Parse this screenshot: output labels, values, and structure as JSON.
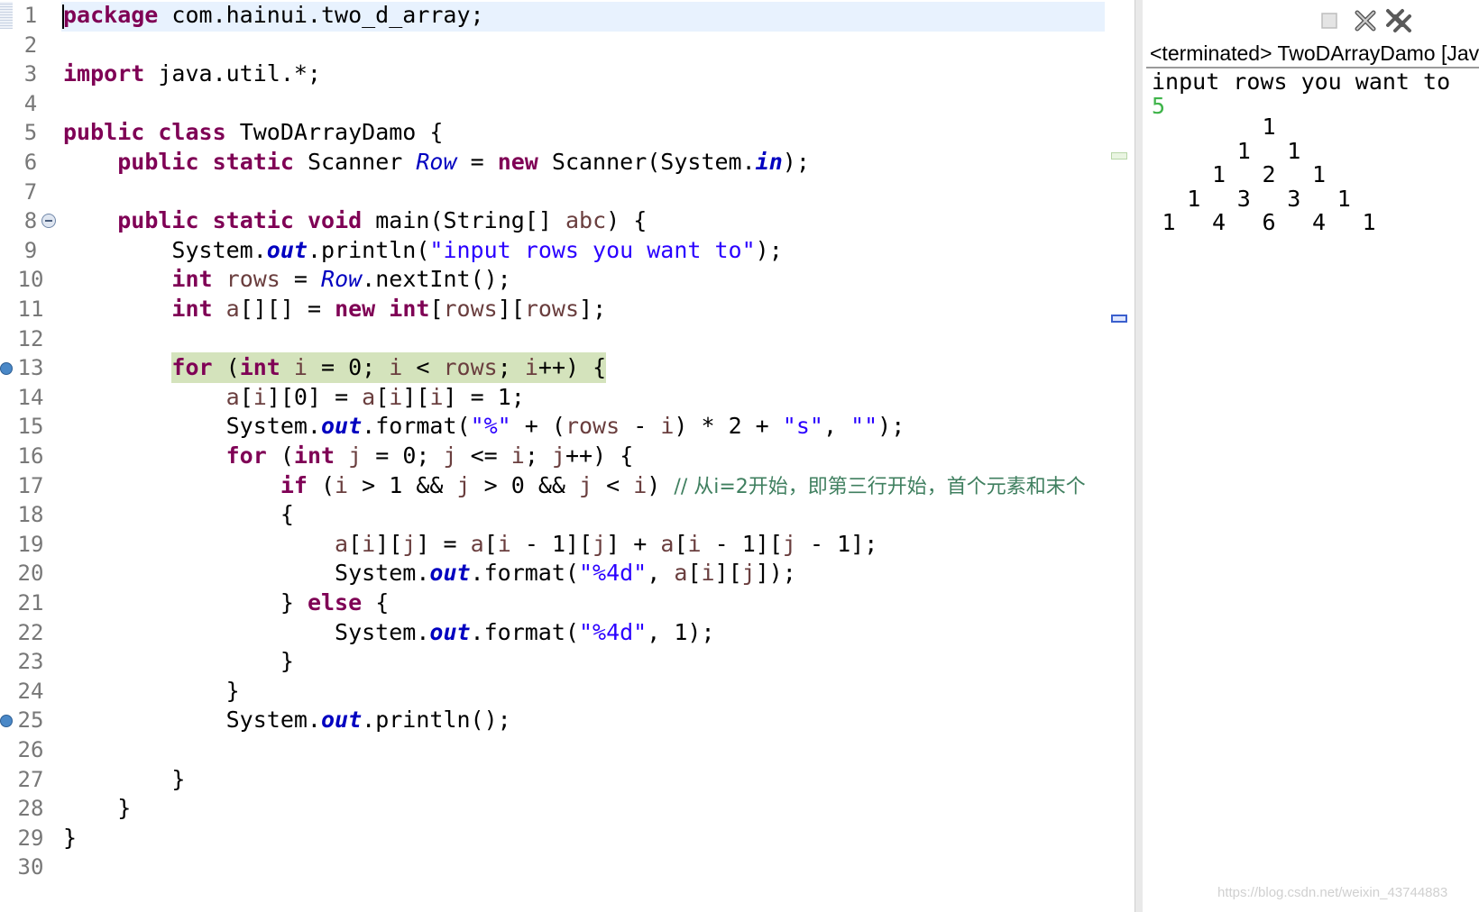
{
  "editor": {
    "lines": [
      {
        "n": "1",
        "segs": [
          [
            "kw",
            "package"
          ],
          [
            "",
            " com.hainui.two_d_array;"
          ]
        ]
      },
      {
        "n": "2",
        "segs": []
      },
      {
        "n": "3",
        "segs": [
          [
            "kw",
            "import"
          ],
          [
            "",
            " java.util.*;"
          ]
        ]
      },
      {
        "n": "4",
        "segs": []
      },
      {
        "n": "5",
        "segs": [
          [
            "kw",
            "public"
          ],
          [
            "",
            " "
          ],
          [
            "kw",
            "class"
          ],
          [
            "",
            " TwoDArrayDamo {"
          ]
        ]
      },
      {
        "n": "6",
        "segs": [
          [
            "",
            "    "
          ],
          [
            "kw",
            "public"
          ],
          [
            "",
            " "
          ],
          [
            "kw",
            "static"
          ],
          [
            "",
            " Scanner "
          ],
          [
            "sfld",
            "Row"
          ],
          [
            "",
            " = "
          ],
          [
            "kw",
            "new"
          ],
          [
            "",
            " Scanner(System."
          ],
          [
            "fld",
            "in"
          ],
          [
            "",
            ");"
          ]
        ]
      },
      {
        "n": "7",
        "segs": []
      },
      {
        "n": "8",
        "segs": [
          [
            "",
            "    "
          ],
          [
            "kw",
            "public"
          ],
          [
            "",
            " "
          ],
          [
            "kw",
            "static"
          ],
          [
            "",
            " "
          ],
          [
            "kw",
            "void"
          ],
          [
            "",
            " main(String[] "
          ],
          [
            "var",
            "abc"
          ],
          [
            "",
            ") {"
          ]
        ]
      },
      {
        "n": "9",
        "segs": [
          [
            "",
            "        System."
          ],
          [
            "fld",
            "out"
          ],
          [
            "",
            ".println("
          ],
          [
            "str",
            "\"input rows you want to\""
          ],
          [
            "",
            ");"
          ]
        ]
      },
      {
        "n": "10",
        "segs": [
          [
            "",
            "        "
          ],
          [
            "kw",
            "int"
          ],
          [
            "",
            " "
          ],
          [
            "var",
            "rows"
          ],
          [
            "",
            " = "
          ],
          [
            "sfld",
            "Row"
          ],
          [
            "",
            ".nextInt();"
          ]
        ]
      },
      {
        "n": "11",
        "segs": [
          [
            "",
            "        "
          ],
          [
            "kw",
            "int"
          ],
          [
            "",
            " "
          ],
          [
            "var",
            "a"
          ],
          [
            "",
            "[][] = "
          ],
          [
            "kw",
            "new"
          ],
          [
            "",
            " "
          ],
          [
            "kw",
            "int"
          ],
          [
            "",
            "["
          ],
          [
            "var",
            "rows"
          ],
          [
            "",
            "]["
          ],
          [
            "var",
            "rows"
          ],
          [
            "",
            "];"
          ]
        ]
      },
      {
        "n": "12",
        "segs": []
      },
      {
        "n": "13",
        "segs": [
          [
            "",
            "        "
          ],
          [
            "hlkw",
            "for"
          ],
          [
            "hl",
            " ("
          ],
          [
            "hlkw",
            "int"
          ],
          [
            "hl",
            " "
          ],
          [
            "hlvar",
            "i"
          ],
          [
            "hl",
            " = 0; "
          ],
          [
            "hlvar",
            "i"
          ],
          [
            "hl",
            " < "
          ],
          [
            "hlvar",
            "rows"
          ],
          [
            "hl",
            "; "
          ],
          [
            "hlvar",
            "i"
          ],
          [
            "hl",
            "++) {"
          ]
        ]
      },
      {
        "n": "14",
        "segs": [
          [
            "",
            "            "
          ],
          [
            "var",
            "a"
          ],
          [
            "",
            "["
          ],
          [
            "var",
            "i"
          ],
          [
            "",
            "][0] = "
          ],
          [
            "var",
            "a"
          ],
          [
            "",
            "["
          ],
          [
            "var",
            "i"
          ],
          [
            "",
            "]["
          ],
          [
            "var",
            "i"
          ],
          [
            "",
            "] = 1;"
          ]
        ]
      },
      {
        "n": "15",
        "segs": [
          [
            "",
            "            System."
          ],
          [
            "fld",
            "out"
          ],
          [
            "",
            ".format("
          ],
          [
            "str",
            "\"%\""
          ],
          [
            "",
            " + ("
          ],
          [
            "var",
            "rows"
          ],
          [
            "",
            " - "
          ],
          [
            "var",
            "i"
          ],
          [
            "",
            ") * 2 + "
          ],
          [
            "str",
            "\"s\""
          ],
          [
            "",
            ", "
          ],
          [
            "str",
            "\"\""
          ],
          [
            "",
            ");"
          ]
        ]
      },
      {
        "n": "16",
        "segs": [
          [
            "",
            "            "
          ],
          [
            "kw",
            "for"
          ],
          [
            "",
            " ("
          ],
          [
            "kw",
            "int"
          ],
          [
            "",
            " "
          ],
          [
            "var",
            "j"
          ],
          [
            "",
            " = 0; "
          ],
          [
            "var",
            "j"
          ],
          [
            "",
            " <= "
          ],
          [
            "var",
            "i"
          ],
          [
            "",
            "; "
          ],
          [
            "var",
            "j"
          ],
          [
            "",
            "++) {"
          ]
        ]
      },
      {
        "n": "17",
        "segs": [
          [
            "",
            "                "
          ],
          [
            "kw",
            "if"
          ],
          [
            "",
            " ("
          ],
          [
            "var",
            "i"
          ],
          [
            "",
            " > 1 && "
          ],
          [
            "var",
            "j"
          ],
          [
            "",
            " > 0 && "
          ],
          [
            "var",
            "j"
          ],
          [
            "",
            " < "
          ],
          [
            "var",
            "i"
          ],
          [
            "",
            ") "
          ],
          [
            "cmt",
            "// 从i=2开始，即第三行开始，首个元素和末个"
          ]
        ]
      },
      {
        "n": "18",
        "segs": [
          [
            "",
            "                {"
          ]
        ]
      },
      {
        "n": "19",
        "segs": [
          [
            "",
            "                    "
          ],
          [
            "var",
            "a"
          ],
          [
            "",
            "["
          ],
          [
            "var",
            "i"
          ],
          [
            "",
            "]["
          ],
          [
            "var",
            "j"
          ],
          [
            "",
            "] = "
          ],
          [
            "var",
            "a"
          ],
          [
            "",
            "["
          ],
          [
            "var",
            "i"
          ],
          [
            "",
            " - 1]["
          ],
          [
            "var",
            "j"
          ],
          [
            "",
            "] + "
          ],
          [
            "var",
            "a"
          ],
          [
            "",
            "["
          ],
          [
            "var",
            "i"
          ],
          [
            "",
            " - 1]["
          ],
          [
            "var",
            "j"
          ],
          [
            "",
            " - 1];"
          ]
        ]
      },
      {
        "n": "20",
        "segs": [
          [
            "",
            "                    System."
          ],
          [
            "fld",
            "out"
          ],
          [
            "",
            ".format("
          ],
          [
            "str",
            "\"%4d\""
          ],
          [
            "",
            ", "
          ],
          [
            "var",
            "a"
          ],
          [
            "",
            "["
          ],
          [
            "var",
            "i"
          ],
          [
            "",
            "]["
          ],
          [
            "var",
            "j"
          ],
          [
            "",
            "]);"
          ]
        ]
      },
      {
        "n": "21",
        "segs": [
          [
            "",
            "                } "
          ],
          [
            "kw",
            "else"
          ],
          [
            "",
            " {"
          ]
        ]
      },
      {
        "n": "22",
        "segs": [
          [
            "",
            "                    System."
          ],
          [
            "fld",
            "out"
          ],
          [
            "",
            ".format("
          ],
          [
            "str",
            "\"%4d\""
          ],
          [
            "",
            ", 1);"
          ]
        ]
      },
      {
        "n": "23",
        "segs": [
          [
            "",
            "                }"
          ]
        ]
      },
      {
        "n": "24",
        "segs": [
          [
            "",
            "            }"
          ]
        ]
      },
      {
        "n": "25",
        "segs": [
          [
            "",
            "            System."
          ],
          [
            "fld",
            "out"
          ],
          [
            "",
            ".println();"
          ]
        ]
      },
      {
        "n": "26",
        "segs": []
      },
      {
        "n": "27",
        "segs": [
          [
            "",
            "        }"
          ]
        ]
      },
      {
        "n": "28",
        "segs": [
          [
            "",
            "    }"
          ]
        ]
      },
      {
        "n": "29",
        "segs": [
          [
            "",
            "}"
          ]
        ]
      },
      {
        "n": "30",
        "segs": []
      }
    ],
    "fold_lines": [
      8
    ],
    "marker_lines": [
      13,
      25
    ]
  },
  "console": {
    "title": "<terminated> TwoDArrayDamo [Jav",
    "prompt_output": "input rows you want to",
    "user_input": "5",
    "triangle_rows": [
      [
        "1"
      ],
      [
        "1",
        "1"
      ],
      [
        "1",
        "2",
        "1"
      ],
      [
        "1",
        "3",
        "3",
        "1"
      ],
      [
        "1",
        "4",
        "6",
        "4",
        "1"
      ]
    ],
    "toolbar": {
      "clear_icon": "stop-icon",
      "remove_icon": "remove-launch-icon",
      "remove_all_icon": "remove-all-icon"
    }
  },
  "watermark": "https://blog.csdn.net/weixin_43744883",
  "colors": {
    "keyword": "#7f0055",
    "field": "#0000c0",
    "string": "#2a00ff",
    "comment": "#3f7f5f",
    "local_var": "#6a3e3e",
    "line_highlight": "#e8f2fe",
    "debug_highlight": "#d4e3bc",
    "console_input": "#3fb44a"
  }
}
